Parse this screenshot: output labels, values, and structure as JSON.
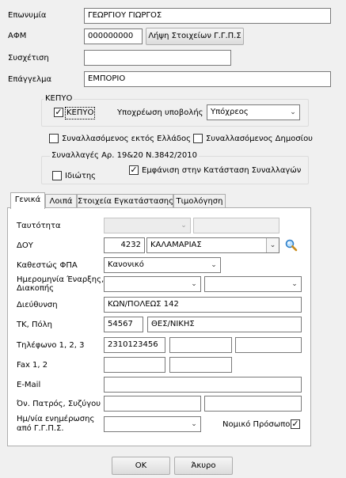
{
  "fields": {
    "name_label": "Επωνυμία",
    "name_value": "ΓΕΩΡΓΙΟΥ ΓΙΩΡΓΟΣ",
    "afm_label": "ΑΦΜ",
    "afm_value": "000000000",
    "fetch_button": "Λήψη Στοιχείων Γ.Γ.Π.Σ",
    "relation_label": "Συσχέτιση",
    "relation_value": "",
    "profession_label": "Επάγγελμα",
    "profession_value": "ΕΜΠΟΡΙΟ"
  },
  "kepyo": {
    "group_title": "ΚΕΠΥΟ",
    "checkbox_label": "ΚΕΠΥΟ",
    "checkbox_checked": true,
    "obligation_label": "Υποχρέωση υποβολής",
    "obligation_value": "Υπόχρεος"
  },
  "options": {
    "foreign_label": "Συναλλασόμενος εκτός Ελλάδος",
    "foreign_checked": false,
    "public_label": "Συναλλασόμενος Δημοσίου",
    "public_checked": false
  },
  "transactions": {
    "group_title": "Συναλλαγές Αρ. 19&20 Ν.3842/2010",
    "private_label": "Ιδιώτης",
    "private_checked": false,
    "show_label": "Εμφάνιση στην Κατάσταση Συναλλαγών",
    "show_checked": true
  },
  "tabs": [
    {
      "label": "Γενικά"
    },
    {
      "label": "Λοιπά"
    },
    {
      "label": "Στοιχεία Εγκατάστασης"
    },
    {
      "label": "Τιμολόγηση"
    }
  ],
  "general": {
    "id_label": "Ταυτότητα",
    "id_value": "",
    "id_number": "",
    "doy_label": "ΔΟΥ",
    "doy_code": "4232",
    "doy_name": "ΚΑΛΑΜΑΡΙΑΣ",
    "vat_label": "Καθεστώς ΦΠΑ",
    "vat_value": "Κανονικό",
    "dates_label_1": "Ημερομηνία Έναρξης,",
    "dates_label_2": "Διακοπής",
    "start_date": "",
    "end_date": "",
    "address_label": "Διεύθυνση",
    "address_value": "ΚΩΝ/ΠΟΛΕΩΣ 142",
    "zip_city_label": "ΤΚ, Πόλη",
    "zip_value": "54567",
    "city_value": "ΘΕΣ/ΝΙΚΗΣ",
    "phone_label": "Τηλέφωνο 1, 2, 3",
    "phone1": "2310123456",
    "phone2": "",
    "phone3": "",
    "fax_label": "Fax 1, 2",
    "fax1": "",
    "fax2": "",
    "email_label": "E-Mail",
    "email_value": "",
    "parents_label": "Όν. Πατρός, Συζύγου",
    "father_value": "",
    "spouse_value": "",
    "update_label_1": "Ημ/νία ενημέρωσης",
    "update_label_2": "από Γ.Γ.Π.Σ.",
    "update_value": "",
    "legal_label": "Νομικό Πρόσωπο",
    "legal_checked": true
  },
  "footer": {
    "ok_label": "OK",
    "cancel_label": "Άκυρο"
  },
  "icons": {
    "search": "search-icon",
    "dropdown": "chevron-down-icon"
  }
}
